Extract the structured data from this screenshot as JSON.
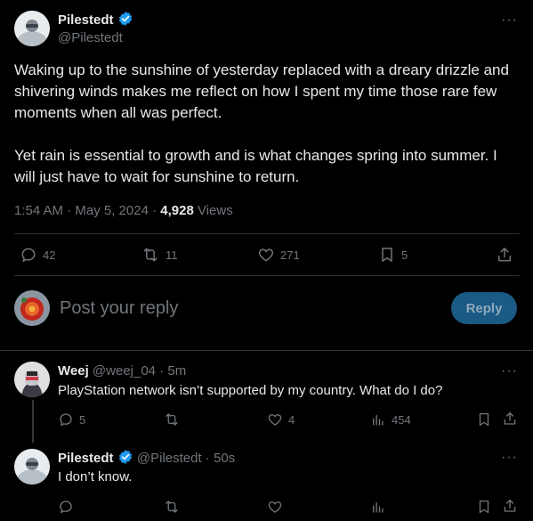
{
  "tweet": {
    "author_name": "Pilestedt",
    "author_handle": "@Pilestedt",
    "paragraph1": "Waking up to the sunshine of yesterday replaced with a dreary drizzle and shivering winds makes me reflect on how I spent my time those rare few moments when all was perfect.",
    "paragraph2": "Yet rain is essential to growth and is what changes spring into summer. I will just have to wait for sunshine to return.",
    "timestamp": "1:54 AM · May 5, 2024 · ",
    "views_count": "4,928",
    "views_label": " Views",
    "stats": {
      "replies": "42",
      "retweets": "11",
      "likes": "271",
      "bookmarks": "5"
    }
  },
  "composer": {
    "placeholder": "Post your reply",
    "reply_button": "Reply"
  },
  "replies": [
    {
      "author_name": "Weej",
      "author_handle": "@weej_04",
      "time": " · 5m",
      "text": "PlayStation network isn’t supported by my country. What do I do?",
      "stats": {
        "replies": "5",
        "retweets": "",
        "likes": "4",
        "views": "454"
      }
    },
    {
      "author_name": "Pilestedt",
      "author_handle": "@Pilestedt",
      "time": " · 50s",
      "text": "I don’t know.",
      "stats": {
        "replies": "",
        "retweets": "",
        "likes": "",
        "views": ""
      }
    }
  ],
  "colors": {
    "background": "#000000",
    "text": "#e7e9ea",
    "secondary": "#71767b",
    "accent": "#1d9bf0",
    "reply_button_bg": "#1a5a85",
    "divider": "#2f3336"
  },
  "icons": [
    "more-icon",
    "verified-icon",
    "reply-icon",
    "retweet-icon",
    "like-icon",
    "bookmark-icon",
    "share-icon",
    "views-icon"
  ]
}
